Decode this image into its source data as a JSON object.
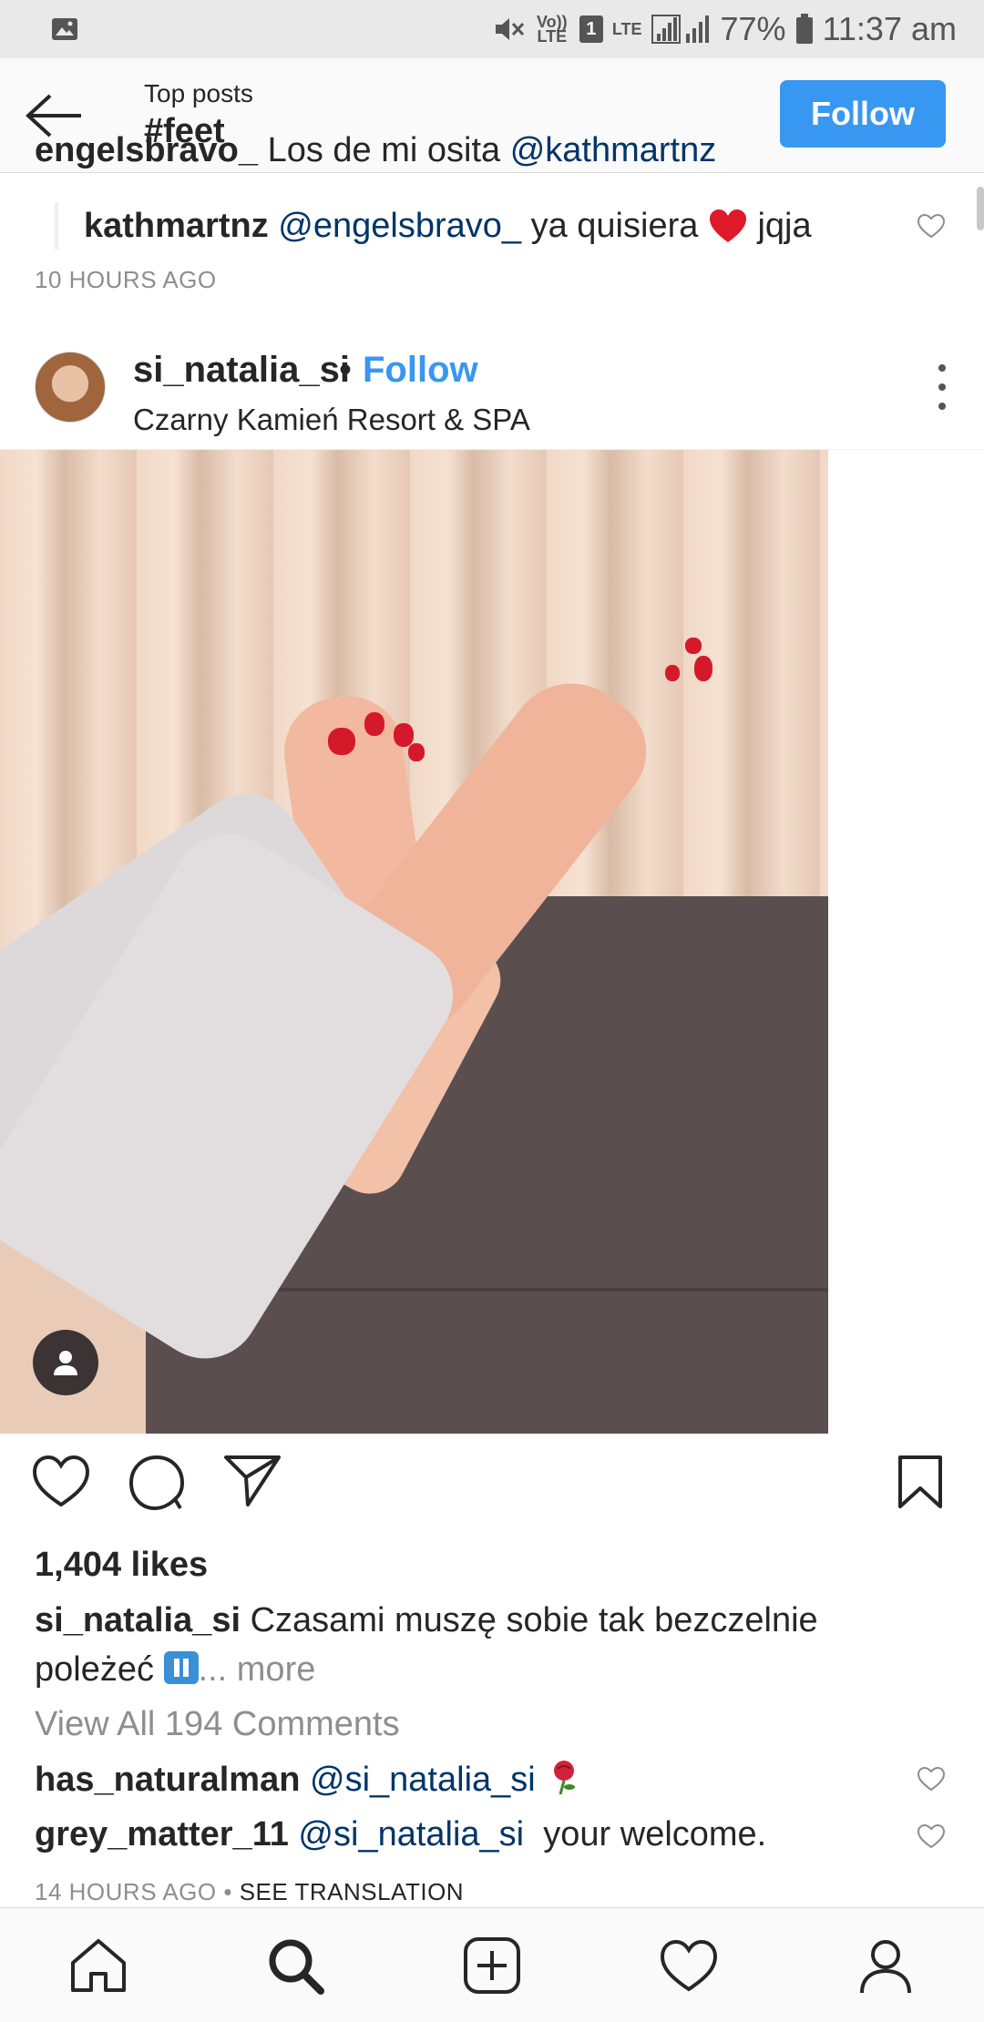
{
  "status_bar": {
    "battery": "77%",
    "time": "11:37 am",
    "volte": "Vo)) LTE",
    "sim": "1",
    "lte": "LTE"
  },
  "header": {
    "subtitle": "Top posts",
    "title": "#feet",
    "follow_label": "Follow"
  },
  "previous_post": {
    "comment_user": "engelsbravo_",
    "comment_text": "Los de mi osita",
    "comment_mention": "@kathmartnz",
    "reply": {
      "user": "kathmartnz",
      "mention": "@engelsbravo_",
      "text_before_emoji": "ya quisiera",
      "text_after_emoji": "jqja"
    },
    "timestamp": "10 HOURS AGO"
  },
  "post": {
    "username": "si_natalia_si",
    "separator": "•",
    "follow_label": "Follow",
    "location": "Czarny Kamień Resort & SPA",
    "likes": "1,404 likes",
    "caption_user": "si_natalia_si",
    "caption_text": "Czasami muszę sobie tak bezczelnie poleżeć",
    "caption_more": "... more",
    "view_all": "View All 194 Comments",
    "comments": [
      {
        "user": "has_naturalman",
        "mention": "@si_natalia_si",
        "text": ""
      },
      {
        "user": "grey_matter_11",
        "mention": "@si_natalia_si",
        "text": "your welcome."
      }
    ],
    "timestamp": "14 HOURS AGO",
    "timestamp_sep": "•",
    "see_translation": "SEE TRANSLATION"
  },
  "colors": {
    "accent_blue": "#3897f0",
    "mention_blue": "#003569",
    "text_gray": "#8e8e8e"
  },
  "icons": {
    "nav": [
      "home-icon",
      "search-icon",
      "new-post-icon",
      "activity-heart-icon",
      "profile-icon"
    ],
    "actions": [
      "like-heart-icon",
      "comment-bubble-icon",
      "share-direct-icon",
      "save-bookmark-icon"
    ]
  }
}
